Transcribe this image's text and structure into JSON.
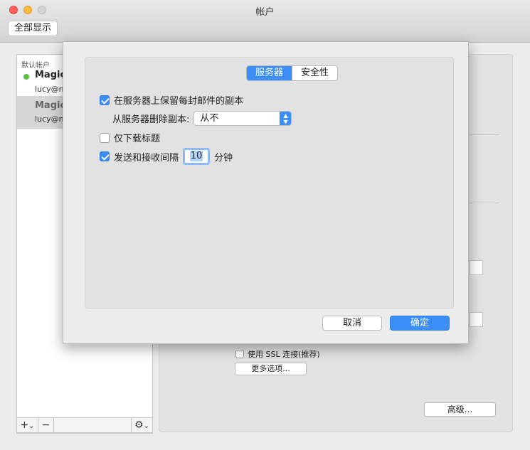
{
  "window": {
    "title": "帐户",
    "show_all_label": "全部显示"
  },
  "sidebar": {
    "section_label": "默认帐户",
    "accounts": [
      {
        "name": "Magic",
        "email": "lucy@m",
        "online": true
      },
      {
        "name": "Magic",
        "email": "lucy@m",
        "online": false
      }
    ],
    "footer": {
      "add_label": "+",
      "add_menu_label": "⌄",
      "remove_label": "−",
      "gear_label": "⚙",
      "gear_menu_label": "⌄"
    }
  },
  "panel": {
    "ssl_label": "使用 SSL 连接(推荐)",
    "more_options_label": "更多选项...",
    "advanced_label": "高级..."
  },
  "sheet": {
    "tabs": [
      {
        "label": "服务器",
        "active": true
      },
      {
        "label": "安全性",
        "active": false
      }
    ],
    "keep_copy": {
      "label": "在服务器上保留每封邮件的副本",
      "checked": true
    },
    "delete_copy": {
      "label": "从服务器删除副本:",
      "value": "从不"
    },
    "headers_only": {
      "label": "仅下载标题",
      "checked": false
    },
    "send_receive": {
      "label": "发送和接收间隔",
      "checked": true,
      "interval": "10",
      "unit": "分钟"
    },
    "cancel_label": "取消",
    "ok_label": "确定"
  },
  "colors": {
    "accent": "#3a8ef6",
    "online": "#5cc045"
  }
}
